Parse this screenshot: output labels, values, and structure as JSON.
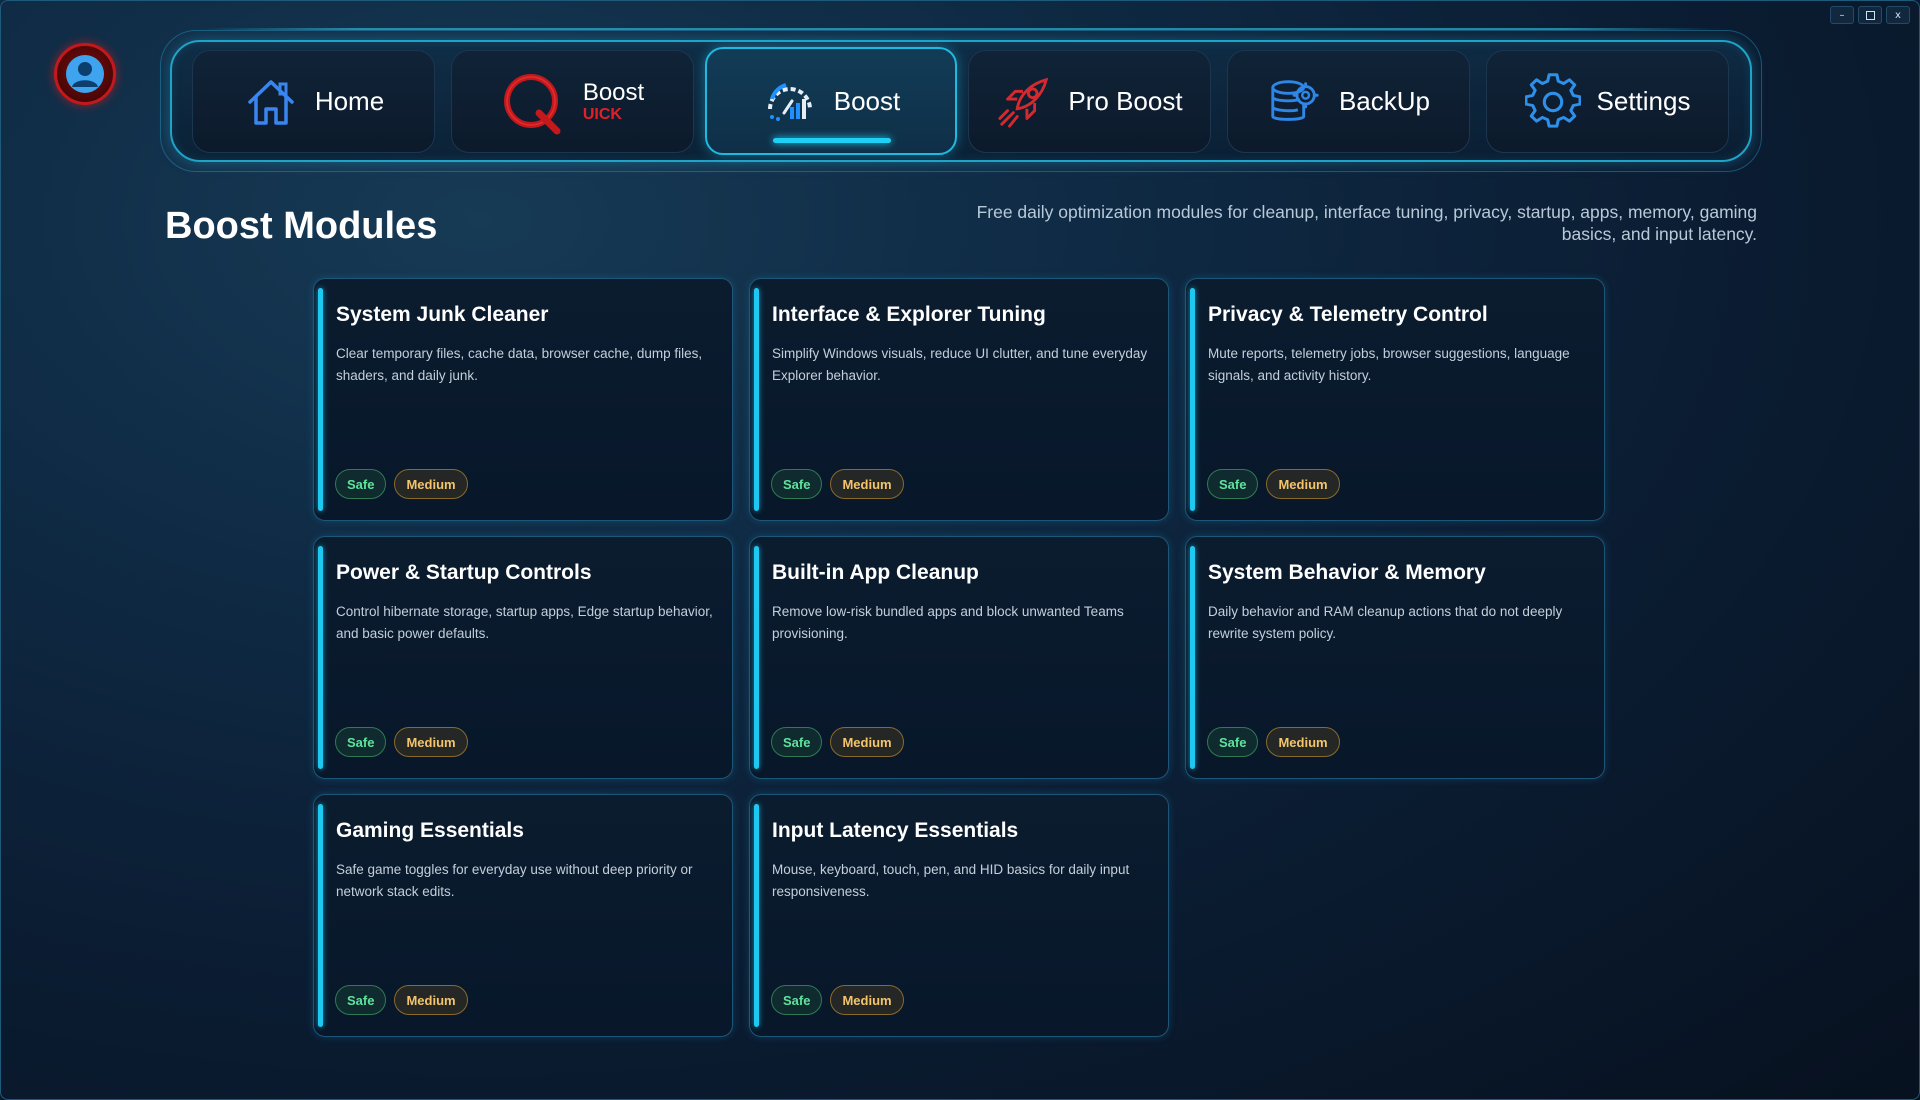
{
  "window": {
    "minimize": "–",
    "close": "x"
  },
  "nav": {
    "tabs": [
      {
        "label": "Home",
        "icon": "home-icon"
      },
      {
        "label": "Boost",
        "sub": "UICK",
        "icon": "quickboost-logo-icon"
      },
      {
        "label": "Boost",
        "icon": "gauge-icon",
        "active": true
      },
      {
        "label": "Pro Boost",
        "icon": "rocket-icon"
      },
      {
        "label": "BackUp",
        "icon": "database-gear-icon"
      },
      {
        "label": "Settings",
        "icon": "gear-icon"
      }
    ]
  },
  "page": {
    "title": "Boost Modules",
    "description": "Free daily optimization modules for cleanup, interface tuning, privacy, startup, apps, memory, gaming basics, and input latency."
  },
  "modules": [
    {
      "title": "System Junk Cleaner",
      "desc": "Clear temporary files, cache data, browser cache, dump files, shaders, and daily junk.",
      "badges": [
        "Safe",
        "Medium"
      ]
    },
    {
      "title": "Interface & Explorer Tuning",
      "desc": "Simplify Windows visuals, reduce UI clutter, and tune everyday Explorer behavior.",
      "badges": [
        "Safe",
        "Medium"
      ]
    },
    {
      "title": "Privacy & Telemetry Control",
      "desc": "Mute reports, telemetry jobs, browser suggestions, language signals, and activity history.",
      "badges": [
        "Safe",
        "Medium"
      ]
    },
    {
      "title": "Power & Startup Controls",
      "desc": "Control hibernate storage, startup apps, Edge startup behavior, and basic power defaults.",
      "badges": [
        "Safe",
        "Medium"
      ]
    },
    {
      "title": "Built-in App Cleanup",
      "desc": "Remove low-risk bundled apps and block unwanted Teams provisioning.",
      "badges": [
        "Safe",
        "Medium"
      ]
    },
    {
      "title": "System Behavior & Memory",
      "desc": "Daily behavior and RAM cleanup actions that do not deeply rewrite system policy.",
      "badges": [
        "Safe",
        "Medium"
      ]
    },
    {
      "title": "Gaming Essentials",
      "desc": "Safe game toggles for everyday use without deep priority or network stack edits.",
      "badges": [
        "Safe",
        "Medium"
      ]
    },
    {
      "title": "Input Latency Essentials",
      "desc": "Mouse, keyboard, touch, pen, and HID basics for daily input responsiveness.",
      "badges": [
        "Safe",
        "Medium"
      ]
    }
  ],
  "colors": {
    "accent": "#1ec8f0",
    "safe": "#5fe39b",
    "medium": "#f4c46a",
    "brand_red": "#e02126"
  }
}
